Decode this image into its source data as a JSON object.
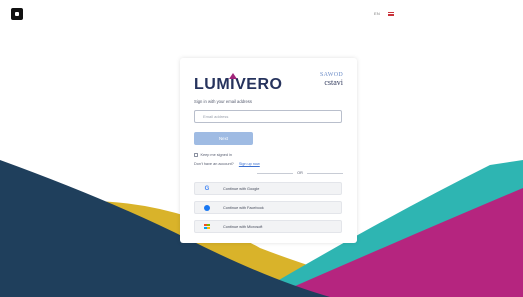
{
  "header": {
    "language_code": "EN",
    "flag_icon": "uk-flag-icon"
  },
  "brand": {
    "name": "LUMIVERO",
    "partner_top": "SAWOD",
    "partner_bottom": "cstavi",
    "colors": {
      "navy": "#26335d",
      "magenta": "#a1247a",
      "gold": "#d9b32a",
      "teal": "#2eb5b2"
    }
  },
  "login": {
    "subtitle": "Sign in with your email address",
    "email_placeholder": "Email address",
    "next_label": "Next",
    "keep_signed_in_label": "Keep me signed in",
    "no_account_text": "Don't have an account?",
    "sign_up_label": "Sign up now",
    "or_text": "OR"
  },
  "providers": [
    {
      "label": "Continue with Google",
      "icon": "google-icon"
    },
    {
      "label": "Continue with Facebook",
      "icon": "facebook-icon"
    },
    {
      "label": "Continue with Microsoft",
      "icon": "microsoft-icon"
    }
  ]
}
